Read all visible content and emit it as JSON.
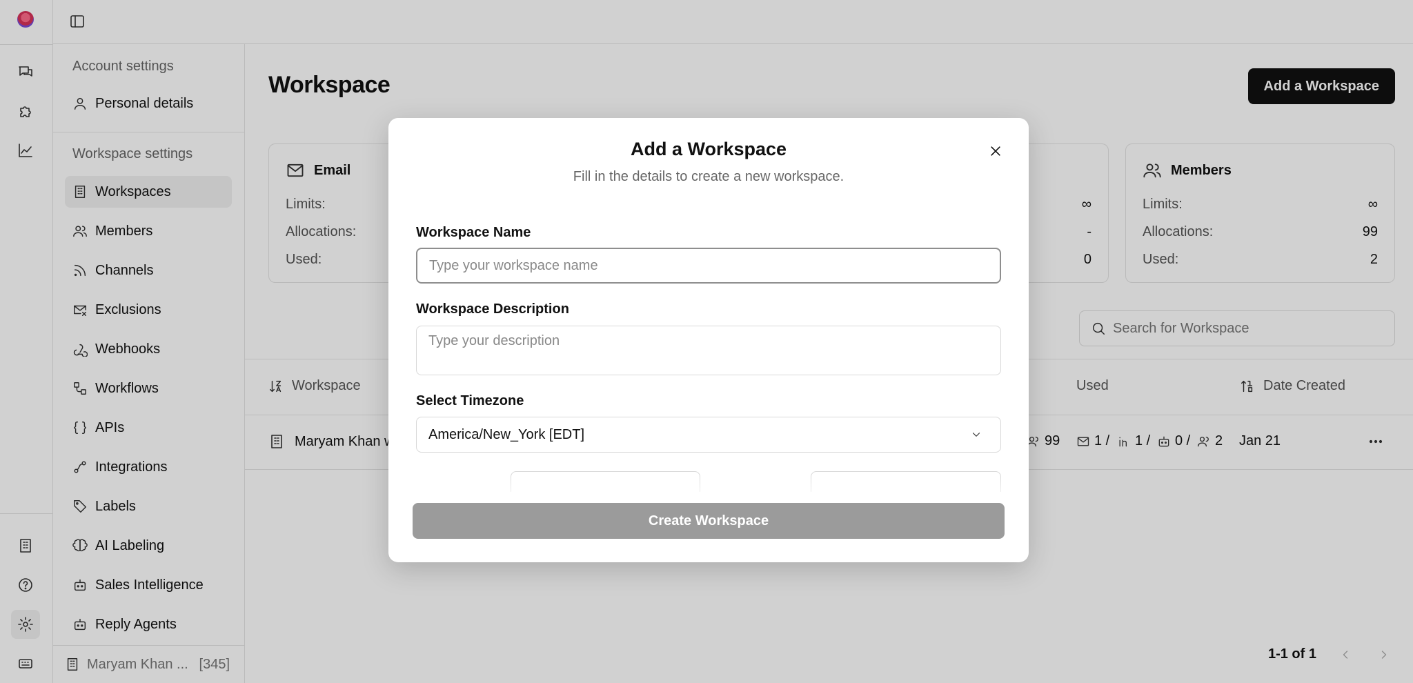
{
  "rail": {
    "top_icons": [
      "chat-icon",
      "puzzle-icon",
      "chart-icon"
    ],
    "bottom_icons": [
      "building-icon",
      "help-icon",
      "gear-icon",
      "keyboard-icon"
    ]
  },
  "sidebar": {
    "account_heading": "Account settings",
    "account_items": [
      {
        "label": "Personal details",
        "icon": "user-icon"
      }
    ],
    "workspace_heading": "Workspace settings",
    "workspace_items": [
      {
        "label": "Workspaces",
        "icon": "building-icon",
        "active": true
      },
      {
        "label": "Members",
        "icon": "users-icon"
      },
      {
        "label": "Channels",
        "icon": "rss-icon"
      },
      {
        "label": "Exclusions",
        "icon": "mail-x-icon"
      },
      {
        "label": "Webhooks",
        "icon": "webhook-icon"
      },
      {
        "label": "Workflows",
        "icon": "workflow-icon"
      },
      {
        "label": "APIs",
        "icon": "braces-icon"
      },
      {
        "label": "Integrations",
        "icon": "integration-icon"
      },
      {
        "label": "Labels",
        "icon": "tag-icon"
      },
      {
        "label": "AI Labeling",
        "icon": "brain-icon"
      },
      {
        "label": "Sales Intelligence",
        "icon": "bot-icon"
      },
      {
        "label": "Reply Agents",
        "icon": "bot-icon"
      }
    ],
    "footer": {
      "name": "Maryam Khan ...",
      "count": "[345]"
    }
  },
  "main": {
    "title": "Workspace",
    "add_button": "Add a Workspace",
    "cards": {
      "email": {
        "title": "Email",
        "limits_label": "Limits:",
        "allocations_label": "Allocations:",
        "used_label": "Used:"
      },
      "middle": {
        "limits_value": "∞",
        "allocations_value": "-",
        "used_value": "0"
      },
      "members": {
        "title": "Members",
        "limits_label": "Limits:",
        "limits_value": "∞",
        "allocations_label": "Allocations:",
        "allocations_value": "99",
        "used_label": "Used:",
        "used_value": "2"
      }
    },
    "search_placeholder": "Search for Workspace",
    "table": {
      "headers": {
        "workspace": "Workspace",
        "used": "Used",
        "date_created": "Date Created"
      },
      "row": {
        "name": "Maryam Khan w",
        "members_alloc": "99",
        "used_email": "1 /",
        "used_linkedin": "1 /",
        "used_bot": "0 /",
        "used_members": "2",
        "date": "Jan 21"
      }
    },
    "pagination": "1-1 of 1"
  },
  "modal": {
    "title": "Add a Workspace",
    "subtitle": "Fill in the details to create a new workspace.",
    "name_label": "Workspace Name",
    "name_placeholder": "Type your workspace name",
    "description_label": "Workspace Description",
    "description_placeholder": "Type your description",
    "timezone_label": "Select Timezone",
    "timezone_value": "America/New_York [EDT]",
    "submit": "Create Workspace"
  }
}
